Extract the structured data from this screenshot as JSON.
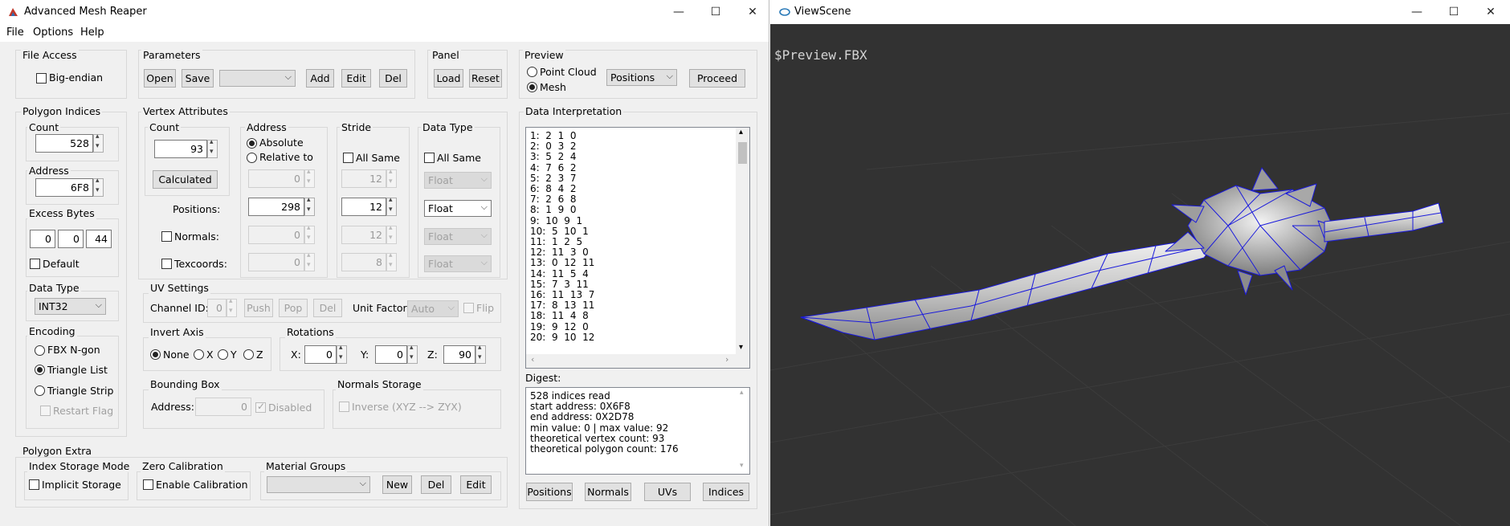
{
  "main_window": {
    "title": "Advanced Mesh Reaper",
    "controls": {
      "minimize": "—",
      "maximize": "☐",
      "close": "✕"
    },
    "menu": [
      "File",
      "Options",
      "Help"
    ]
  },
  "file_access": {
    "title": "File Access",
    "big_endian": "Big-endian"
  },
  "parameters": {
    "title": "Parameters",
    "open": "Open",
    "save": "Save",
    "add": "Add",
    "edit": "Edit",
    "del": "Del"
  },
  "panel": {
    "title": "Panel",
    "load": "Load",
    "reset": "Reset"
  },
  "preview": {
    "title": "Preview",
    "point_cloud": "Point Cloud",
    "mesh": "Mesh",
    "mode": "Positions",
    "proceed": "Proceed"
  },
  "polygon_indices": {
    "title": "Polygon Indices",
    "count_label": "Count",
    "count": "528",
    "address_label": "Address",
    "address": "6F8",
    "excess_label": "Excess Bytes",
    "excess": [
      "0",
      "0",
      "44"
    ],
    "default": "Default",
    "data_type_label": "Data Type",
    "data_type": "INT32",
    "encoding_label": "Encoding",
    "fbx_ngon": "FBX N-gon",
    "triangle_list": "Triangle List",
    "triangle_strip": "Triangle Strip",
    "restart_flag": "Restart Flag"
  },
  "vertex_attributes": {
    "title": "Vertex Attributes",
    "count_label": "Count",
    "count": "93",
    "calculated": "Calculated",
    "address_label": "Address",
    "absolute": "Absolute",
    "relative_to": "Relative to",
    "stride_label": "Stride",
    "all_same": "All Same",
    "data_type_label": "Data Type",
    "all_same_dt": "All Same",
    "positions": "Positions:",
    "normals": "Normals:",
    "texcoords": "Texcoords:",
    "rel_value": "0",
    "address_values": [
      "298",
      "0",
      "0"
    ],
    "stride_top": "12",
    "stride_values": [
      "12",
      "12",
      "8"
    ],
    "float": "Float"
  },
  "uv_settings": {
    "title": "UV Settings",
    "channel_label": "Channel ID:",
    "channel": "0",
    "push": "Push",
    "pop": "Pop",
    "del": "Del",
    "unit_factor_label": "Unit Factor:",
    "unit_factor": "Auto",
    "flip": "Flip"
  },
  "invert_axis": {
    "title": "Invert Axis",
    "none": "None",
    "x": "X",
    "y": "Y",
    "z": "Z"
  },
  "rotations": {
    "title": "Rotations",
    "x_label": "X:",
    "x": "0",
    "y_label": "Y:",
    "y": "0",
    "z_label": "Z:",
    "z": "90"
  },
  "bounding_box": {
    "title": "Bounding Box",
    "address_label": "Address:",
    "address": "0",
    "disabled": "Disabled"
  },
  "normals_storage": {
    "title": "Normals Storage",
    "inverse": "Inverse (XYZ --> ZYX)"
  },
  "polygon_extra": {
    "title": "Polygon Extra",
    "index_storage_title": "Index Storage Mode",
    "implicit_storage": "Implicit Storage",
    "zero_cal_title": "Zero Calibration",
    "enable_calibration": "Enable Calibration",
    "material_title": "Material Groups",
    "new": "New",
    "del": "Del",
    "edit": "Edit"
  },
  "data_interpretation": {
    "title": "Data Interpretation",
    "rows": [
      "1:  2  1  0",
      "2:  0  3  2",
      "3:  5  2  4",
      "4:  7  6  2",
      "5:  2  3  7",
      "6:  8  4  2",
      "7:  2  6  8",
      "8:  1  9  0",
      "9:  10  9  1",
      "10:  5  10  1",
      "11:  1  2  5",
      "12:  11  3  0",
      "13:  0  12  11",
      "14:  11  5  4",
      "15:  7  3  11",
      "16:  11  13  7",
      "17:  8  13  11",
      "18:  11  4  8",
      "19:  9  12  0",
      "20:  9  10  12"
    ]
  },
  "digest": {
    "title": "Digest:",
    "lines": [
      "528 indices read",
      "start address: 0X6F8",
      "end address: 0X2D78",
      "min value: 0 | max value: 92",
      "theoretical vertex count: 93",
      "theoretical polygon count: 176"
    ]
  },
  "bottom_buttons": {
    "positions": "Positions",
    "normals": "Normals",
    "uvs": "UVs",
    "indices": "Indices"
  },
  "view_window": {
    "title": "ViewScene",
    "viewport_label": "$Preview.FBX"
  },
  "colors": {
    "viewport_bg": "#323232",
    "wireframe": "#1a1adc",
    "window_bg": "#f0f0f0"
  }
}
